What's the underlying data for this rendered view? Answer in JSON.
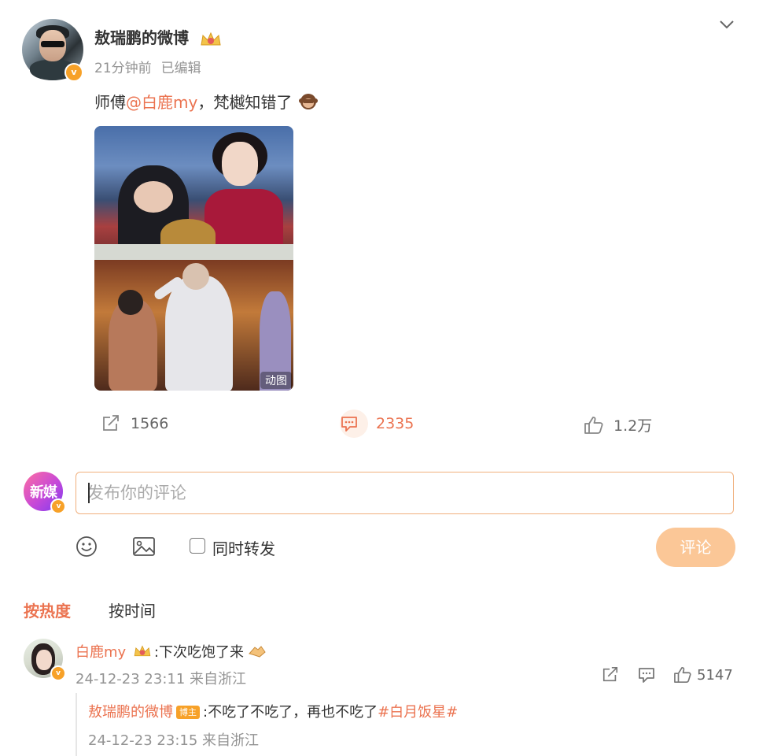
{
  "post": {
    "author": "敖瑞鹏的微博",
    "time": "21分钟前",
    "edited": "已编辑",
    "text_prefix": "师傅",
    "mention": "@白鹿my",
    "text_suffix": "，梵樾知错了",
    "media_badge": "动图",
    "reposts": "1566",
    "comments": "2335",
    "likes": "1.2万"
  },
  "composer": {
    "avatar_text": "新媒",
    "placeholder": "发布你的评论",
    "repost_label": "同时转发",
    "submit_label": "评论"
  },
  "sort": {
    "hot": "按热度",
    "time": "按时间"
  },
  "comments": [
    {
      "author": "白鹿my",
      "text": ":下次吃饱了来",
      "meta": "24-12-23 23:11 来自浙江",
      "likes": "5147",
      "reply": {
        "author": "敖瑞鹏的微博",
        "tag": "博主",
        "text": ":不吃了不吃了，再也不吃了",
        "hashtag": "#白月饭星#",
        "meta": "24-12-23 23:15 来自浙江"
      }
    }
  ],
  "colors": {
    "accent": "#eb7350",
    "submit_disabled": "#fbc797",
    "vip_badge": "#f7a128"
  },
  "icons": [
    "chevron-down-icon",
    "crown-icon",
    "monkey-emoji-icon",
    "repost-icon",
    "comment-icon",
    "like-icon",
    "emoji-icon",
    "image-icon",
    "v-badge-icon",
    "handshake-emoji-icon"
  ]
}
